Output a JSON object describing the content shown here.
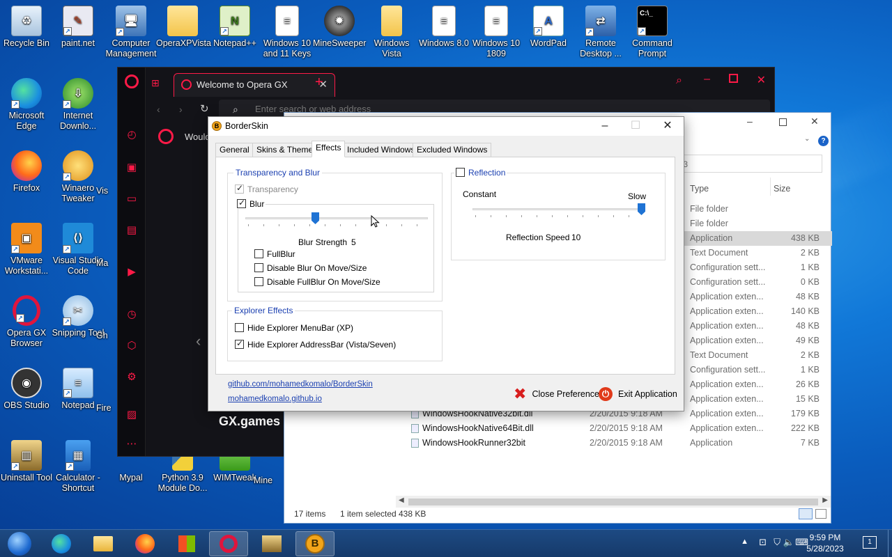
{
  "desktop_icons": [
    {
      "label": "Recycle Bin",
      "icon": "recycle-bin-icon"
    },
    {
      "label": "paint.net",
      "icon": "paintnet-icon"
    },
    {
      "label": "Computer Management",
      "icon": "computer-management-icon"
    },
    {
      "label": "OperaXPVista",
      "icon": "folder-icon"
    },
    {
      "label": "Notepad++",
      "icon": "notepadpp-icon"
    },
    {
      "label": "Windows 10 and 11 Keys",
      "icon": "text-document-icon"
    },
    {
      "label": "MineSweeper",
      "icon": "minesweeper-icon"
    },
    {
      "label": "Windows Vista",
      "icon": "folder-icon"
    },
    {
      "label": "Windows 8.0",
      "icon": "text-document-icon"
    },
    {
      "label": "Windows 10 1809",
      "icon": "text-document-icon"
    },
    {
      "label": "WordPad",
      "icon": "wordpad-icon"
    },
    {
      "label": "Remote Desktop ...",
      "icon": "remote-desktop-icon"
    },
    {
      "label": "Command Prompt",
      "icon": "command-prompt-icon"
    },
    {
      "label": "Microsoft Edge",
      "icon": "edge-icon"
    },
    {
      "label": "Internet Downlo...",
      "icon": "idm-icon"
    },
    {
      "label": "Firefox",
      "icon": "firefox-icon"
    },
    {
      "label": "Winaero Tweaker",
      "icon": "winaero-icon"
    },
    {
      "label": "VMware Workstati...",
      "icon": "vmware-icon"
    },
    {
      "label": "Visual Studio Code",
      "icon": "vscode-icon"
    },
    {
      "label": "Opera GX Browser",
      "icon": "opera-gx-icon"
    },
    {
      "label": "Snipping Tool",
      "icon": "snipping-tool-icon"
    },
    {
      "label": "OBS Studio",
      "icon": "obs-icon"
    },
    {
      "label": "Notepad",
      "icon": "notepad-icon"
    },
    {
      "label": "Uninstall Tool",
      "icon": "uninstall-tool-icon"
    },
    {
      "label": "Calculator - Shortcut",
      "icon": "calculator-icon"
    },
    {
      "label": "Mypal",
      "icon": "mypal-icon"
    },
    {
      "label": "Python 3.9 Module Do...",
      "icon": "python-icon"
    },
    {
      "label": "WIMTweak",
      "icon": "wimtweak-icon"
    }
  ],
  "partial_labels": {
    "vis": "Vis",
    "ma": "Ma",
    "gh": "Gh",
    "fire": "Fire",
    "mine": "Mine"
  },
  "opera": {
    "tab_title": "Welcome to Opera GX",
    "address_placeholder": "Enter search or web address",
    "content_text": "Would",
    "brand": "GX.games"
  },
  "explorer": {
    "address_tail": ".3",
    "col_type": "Type",
    "col_size": "Size",
    "rows": [
      {
        "name": "",
        "date": "",
        "type": "File folder",
        "size": ""
      },
      {
        "name": "",
        "date": "",
        "type": "File folder",
        "size": ""
      },
      {
        "name": "",
        "date": "",
        "type": "Application",
        "size": "438 KB"
      },
      {
        "name": "",
        "date": "",
        "type": "Text Document",
        "size": "2 KB"
      },
      {
        "name": "",
        "date": "",
        "type": "Configuration sett...",
        "size": "1 KB"
      },
      {
        "name": "",
        "date": "",
        "type": "Configuration sett...",
        "size": "0 KB"
      },
      {
        "name": "",
        "date": "",
        "type": "Application exten...",
        "size": "48 KB"
      },
      {
        "name": "",
        "date": "",
        "type": "Application exten...",
        "size": "140 KB"
      },
      {
        "name": "",
        "date": "",
        "type": "Application exten...",
        "size": "48 KB"
      },
      {
        "name": "",
        "date": "",
        "type": "Application exten...",
        "size": "49 KB"
      },
      {
        "name": "",
        "date": "",
        "type": "Text Document",
        "size": "2 KB"
      },
      {
        "name": "",
        "date": "",
        "type": "Configuration sett...",
        "size": "1 KB"
      },
      {
        "name": "",
        "date": "",
        "type": "Application exten...",
        "size": "26 KB"
      },
      {
        "name": "",
        "date": "",
        "type": "Application exten...",
        "size": "15 KB"
      },
      {
        "name": "WindowsHookNative32bit.dll",
        "date": "2/20/2015 9:18 AM",
        "type": "Application exten...",
        "size": "179 KB"
      },
      {
        "name": "WindowsHookNative64Bit.dll",
        "date": "2/20/2015 9:18 AM",
        "type": "Application exten...",
        "size": "222 KB"
      },
      {
        "name": "WindowsHookRunner32bit",
        "date": "2/20/2015 9:18 AM",
        "type": "Application",
        "size": "7 KB"
      }
    ],
    "selected_row": 2,
    "status_items": "17 items",
    "status_selected": "1 item selected",
    "status_size": "438 KB"
  },
  "borderskin": {
    "title": "BorderSkin",
    "tabs": [
      "General",
      "Skins & Themes",
      "Effects",
      "Included Windows",
      "Excluded Windows"
    ],
    "active_tab": 2,
    "transparency_group": "Transparency and Blur",
    "transparency_label": "Transparency",
    "transparency_checked": true,
    "blur_label": "Blur",
    "blur_checked": true,
    "blur_strength_label": "Blur Strength",
    "blur_strength_value": "5",
    "blur_strength_fraction": 0.38,
    "fullblur_label": "FullBlur",
    "disable_blur_label": "Disable Blur On Move/Size",
    "disable_fullblur_label": "Disable FullBlur On Move/Size",
    "explorer_group": "Explorer Effects",
    "hide_menubar_label": "Hide Explorer MenuBar (XP)",
    "hide_menubar_checked": false,
    "hide_addressbar_label": "Hide Explorer AddressBar (Vista/Seven)",
    "hide_addressbar_checked": true,
    "reflection_label": "Reflection",
    "reflection_checked": false,
    "reflection_min_label": "Constant",
    "reflection_max_label": "Slow",
    "reflection_speed_label": "Reflection Speed",
    "reflection_speed_value": "10",
    "reflection_fraction": 1.0,
    "link_github": "github.com/mohamedkomalo/BorderSkin",
    "link_site": "mohamedkomalo.github.io",
    "close_pref_label": "Close Preference",
    "exit_label": "Exit Application"
  },
  "taskbar": {
    "time": "9:59 PM",
    "date": "5/28/2023",
    "notification_count": "1",
    "pinned": [
      "start-orb-icon",
      "edge-icon",
      "file-explorer-icon",
      "firefox-icon",
      "store-icon",
      "opera-gx-icon",
      "archive-icon",
      "borderskin-icon"
    ],
    "active_index": 7
  },
  "colors": {
    "opera_accent": "#ff1a47",
    "link": "#1a3fb0",
    "slider": "#1f73d4"
  }
}
